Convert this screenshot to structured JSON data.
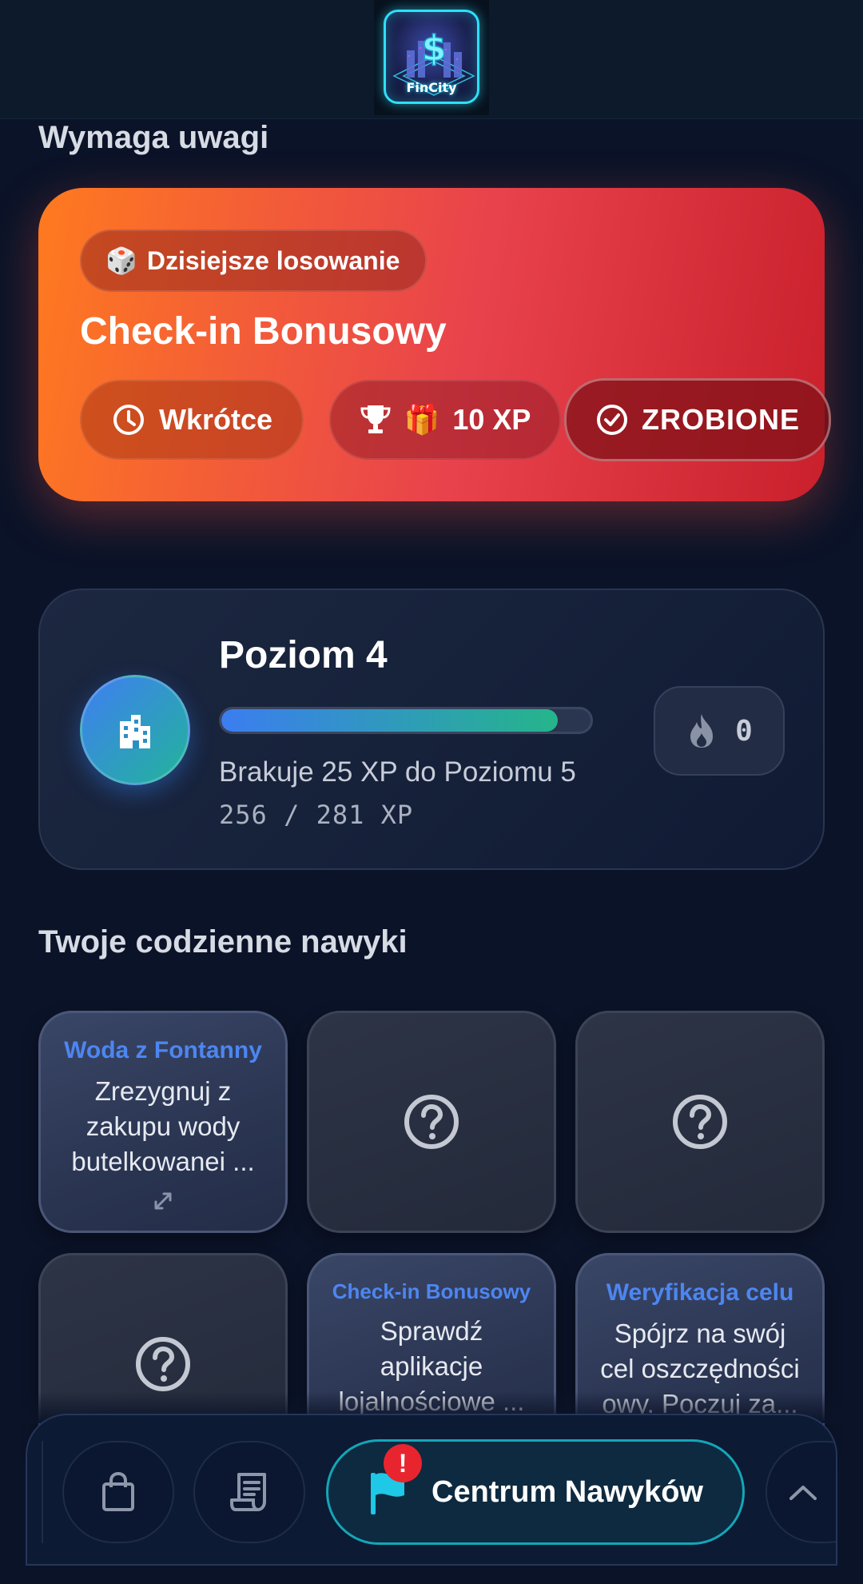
{
  "header": {
    "logo_text": "FinCity"
  },
  "attention": {
    "section_title": "Wymaga uwagi",
    "badge_emoji": "🎲",
    "badge_label": "Dzisiejsze losowanie",
    "title": "Check-in Bonusowy",
    "time_label": "Wkrótce",
    "reward_emoji": "🎁",
    "reward_label": "10 XP",
    "done_label": "ZROBIONE"
  },
  "level": {
    "title": "Poziom 4",
    "progress_fraction": 0.911,
    "need_text": "Brakuje 25 XP do Poziomu 5",
    "xp_text": "256  /  281  XP",
    "streak_value": "0"
  },
  "habits": {
    "section_title": "Twoje codzienne nawyki",
    "tiles": [
      {
        "title": "Woda z Fontanny",
        "text": "Zrezygnuj z zakupu wody butelkowanei ..."
      },
      {
        "locked": true
      },
      {
        "locked": true
      },
      {
        "locked": true
      },
      {
        "title": "Check-in Bonusowy",
        "text": "Sprawdź aplikacje lojalnościowe ..."
      },
      {
        "title": "Weryfikacja celu",
        "text": "Spójrz na swój cel oszczędności owy. Poczuj za..."
      }
    ]
  },
  "bottom_nav": {
    "main_label": "Centrum Nawyków",
    "alert_badge": "!"
  },
  "colors": {
    "accent_blue": "#4d86f0",
    "promo_start": "#ff7a1f",
    "promo_end": "#c9202c",
    "nav_border": "#14a6b8"
  }
}
